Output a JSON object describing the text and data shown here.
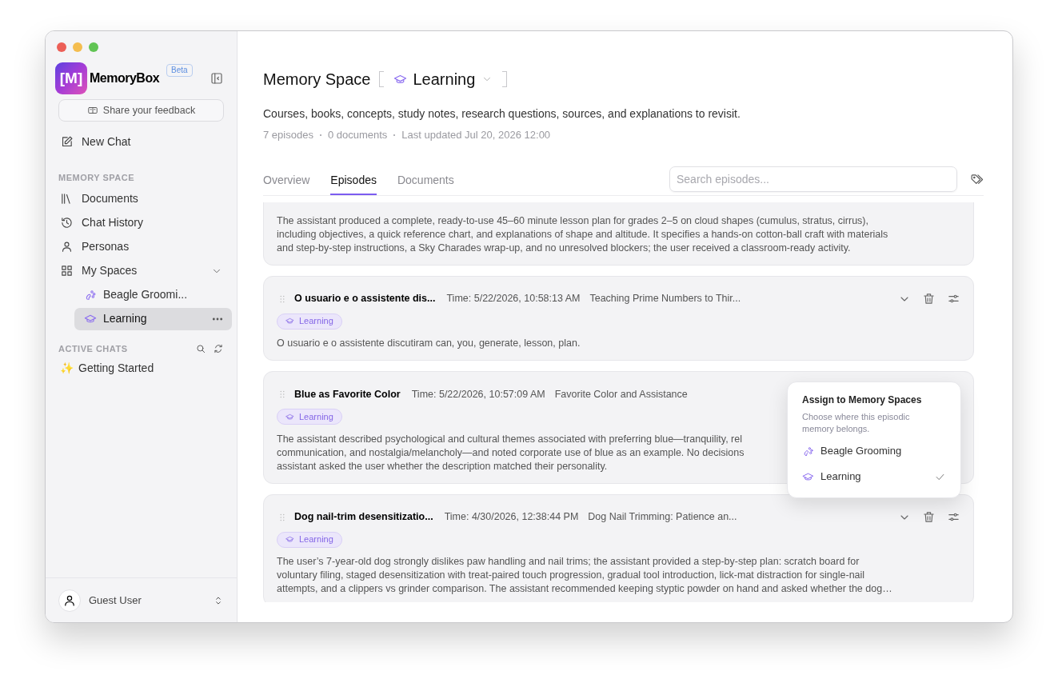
{
  "app": {
    "logo_mark": "[M]",
    "name": "MemoryBox",
    "badge": "Beta",
    "feedback": "Share your feedback",
    "new_chat": "New Chat"
  },
  "sidebar": {
    "memory_section": "MEMORY SPACE",
    "items": [
      {
        "label": "Documents",
        "kind": "documents"
      },
      {
        "label": "Chat History",
        "kind": "history"
      },
      {
        "label": "Personas",
        "kind": "person"
      },
      {
        "label": "My Spaces",
        "kind": "spaces",
        "expanded": true,
        "children": [
          {
            "label": "Beagle Groomi...",
            "kind": "paw",
            "selected": false
          },
          {
            "label": "Learning",
            "kind": "cap",
            "selected": true
          }
        ]
      }
    ],
    "chats_section": "ACTIVE CHATS",
    "chats": [
      {
        "emoji": "✨",
        "label": "Getting Started"
      }
    ],
    "user": "Guest User"
  },
  "header": {
    "title": "Memory Space",
    "space": "Learning",
    "description": "Courses, books, concepts, study notes, research questions, sources, and explanations to revisit.",
    "meta": [
      "7 episodes",
      "0 documents",
      "Last updated Jul 20, 2026 12:00"
    ]
  },
  "tabs": [
    {
      "label": "Overview",
      "selected": false
    },
    {
      "label": "Episodes",
      "selected": true
    },
    {
      "label": "Documents",
      "selected": false
    }
  ],
  "search": {
    "placeholder": "Search episodes..."
  },
  "episodes": [
    {
      "kind": "partial",
      "summary_lines": [
        "The assistant produced a complete, ready-to-use 45–60 minute lesson plan for grades 2–5 on cloud shapes (cumulus, stratus, cirrus),",
        "including objectives, a quick reference chart, and explanations of shape and altitude. It specifies a hands-on cotton-ball craft with materials",
        "and step-by-step instructions, a Sky Charades wrap-up, and no unresolved blockers; the user received a classroom-ready activity."
      ]
    },
    {
      "kind": "full",
      "title": "O usuario e o assistente dis...",
      "time": "Time: 5/22/2026, 10:58:13 AM",
      "topic": "Teaching Prime Numbers to Thir...",
      "tag": "Learning",
      "actions": true,
      "summary_lines": [
        "O usuario e o assistente discutiram can, you, generate, lesson, plan."
      ]
    },
    {
      "kind": "full",
      "title": "Blue as Favorite Color",
      "time": "Time: 5/22/2026, 10:57:09 AM",
      "topic": "Favorite Color and Assistance",
      "tag": "Learning",
      "actions": false,
      "summary_lines": [
        "The assistant described psychological and cultural themes associated with preferring blue—tranquility, rel",
        "communication, and nostalgia/melancholy—and noted corporate use of blue as an example. No decisions",
        "assistant asked the user whether the description matched their personality."
      ]
    },
    {
      "kind": "full",
      "title": "Dog nail-trim desensitizatio...",
      "time": "Time: 4/30/2026, 12:38:44 PM",
      "topic": "Dog Nail Trimming: Patience an...",
      "tag": "Learning",
      "actions": true,
      "summary_lines": [
        "The user’s 7-year-old dog strongly dislikes paw handling and nail trims; the assistant provided a step-by-step plan: scratch board for",
        "voluntary filing, staged desensitization with treat-paired touch progression, gradual tool introduction, lick-mat distraction for single-nail",
        "attempts, and a clippers vs grinder comparison. The assistant recommended keeping styptic powder on hand and asked whether the dog…"
      ]
    }
  ],
  "assign_popup": {
    "title": "Assign to Memory Spaces",
    "subtitle_lines": [
      "Choose where this episodic",
      "memory belongs."
    ],
    "options": [
      {
        "label": "Beagle Grooming",
        "kind": "paw",
        "selected": false
      },
      {
        "label": "Learning",
        "kind": "cap",
        "selected": true
      }
    ]
  }
}
